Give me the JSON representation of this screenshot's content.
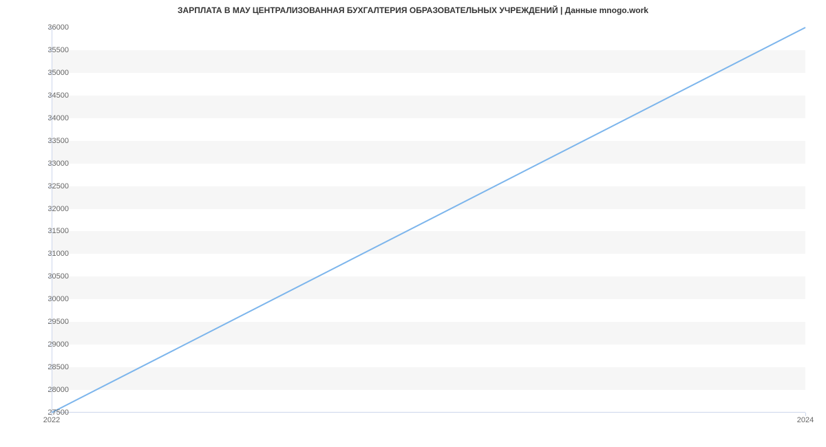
{
  "chart_data": {
    "type": "line",
    "title": "ЗАРПЛАТА В МАУ ЦЕНТРАЛИЗОВАННАЯ БУХГАЛТЕРИЯ ОБРАЗОВАТЕЛЬНЫХ УЧРЕЖДЕНИЙ | Данные mnogo.work",
    "x": [
      2022,
      2024
    ],
    "values": [
      27500,
      36000
    ],
    "xlabel": "",
    "ylabel": "",
    "xlim": [
      2022,
      2024
    ],
    "ylim": [
      27500,
      36000
    ],
    "y_ticks": [
      27500,
      28000,
      28500,
      29000,
      29500,
      30000,
      30500,
      31000,
      31500,
      32000,
      32500,
      33000,
      33500,
      34000,
      34500,
      35000,
      35500,
      36000
    ],
    "x_ticks": [
      2022,
      2024
    ],
    "line_color": "#7cb5ec",
    "grid": "banded"
  }
}
